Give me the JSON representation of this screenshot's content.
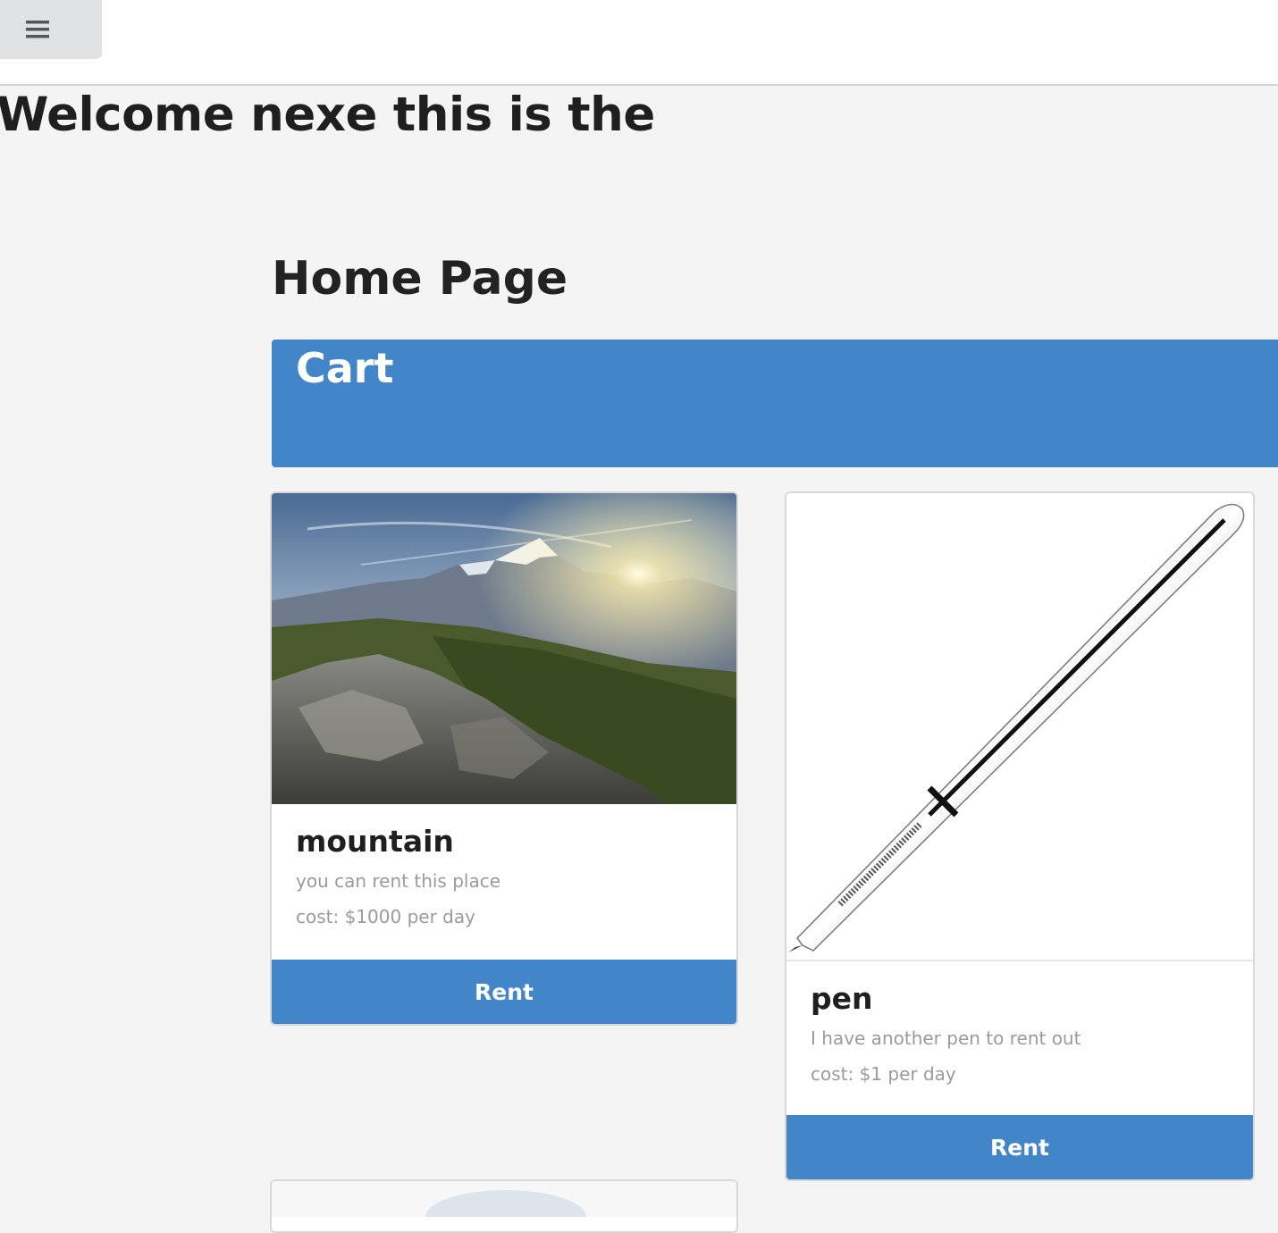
{
  "header": {
    "menu_icon": "hamburger-menu-icon"
  },
  "welcome": {
    "text": "Welcome nexe this is the"
  },
  "page": {
    "title": "Home Page"
  },
  "cart": {
    "title": "Cart"
  },
  "items": [
    {
      "name": "mountain",
      "description": "you can rent this place",
      "cost": "cost: $1000 per day",
      "button_label": "Rent",
      "image": "mountain-sunset-photo"
    },
    {
      "name": "pen",
      "description": "I have another pen to rent out",
      "cost": "cost: $1 per day",
      "button_label": "Rent",
      "image": "chrome-pen-photo"
    }
  ],
  "colors": {
    "accent": "#4285c9",
    "background": "#f4f4f4"
  }
}
